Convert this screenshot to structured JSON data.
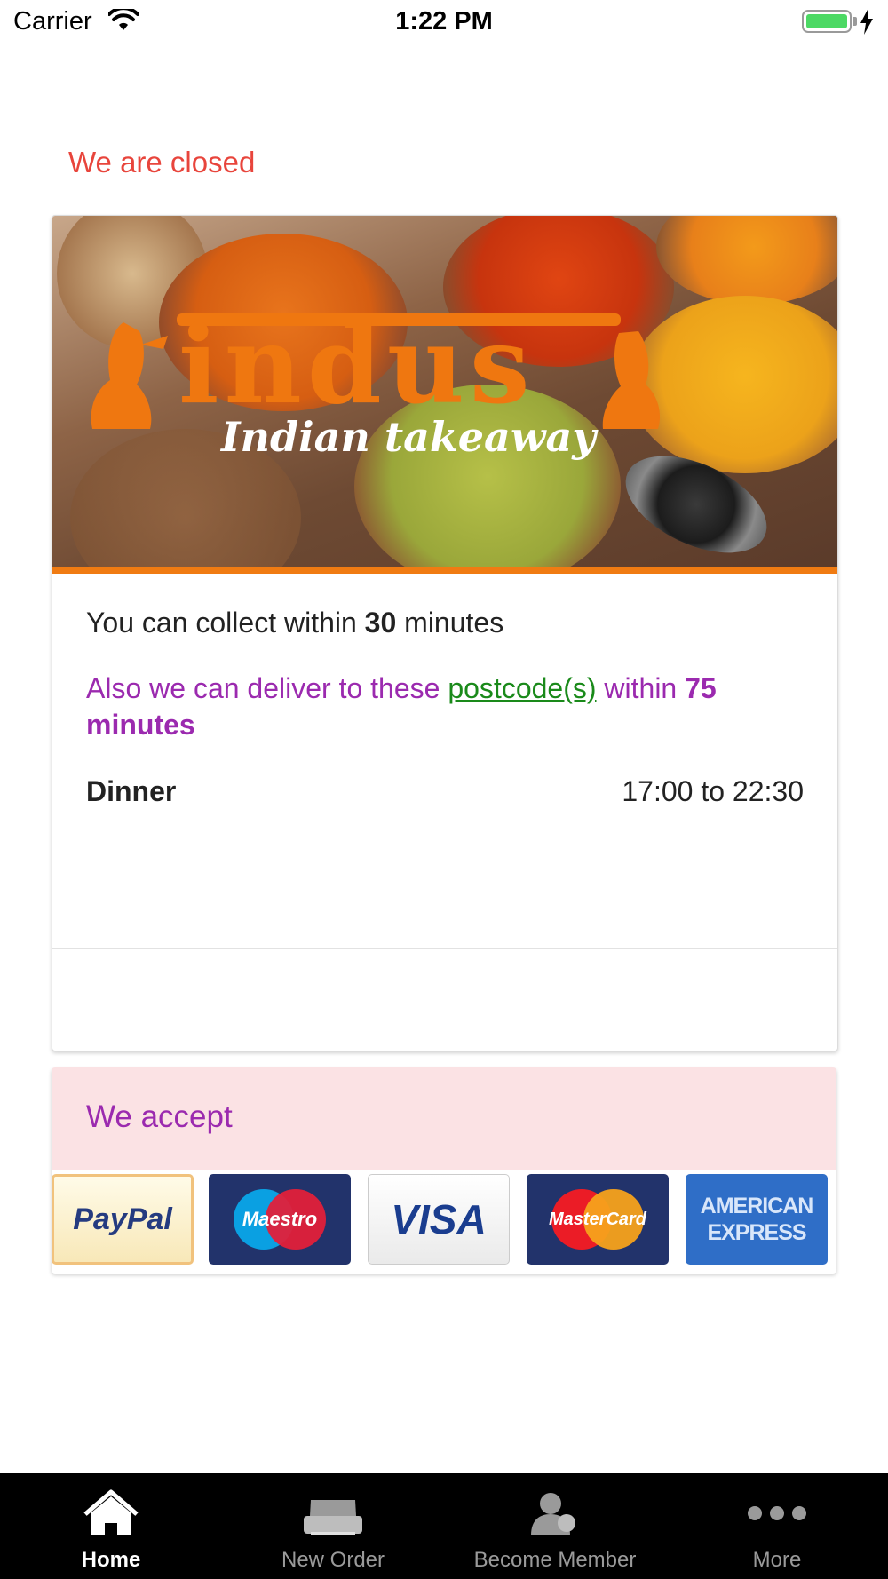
{
  "status_bar": {
    "carrier": "Carrier",
    "time": "1:22 PM"
  },
  "closed_message": "We are closed",
  "hero": {
    "brand": "indus",
    "tagline": "Indian takeaway"
  },
  "collect": {
    "prefix": "You can collect within",
    "minutes": "30",
    "suffix": "minutes"
  },
  "delivery": {
    "prefix": "Also we can deliver to these",
    "link_text": "postcode(s)",
    "middle": "within",
    "minutes": "75",
    "unit": "minutes"
  },
  "meal": {
    "name": "Dinner",
    "hours": "17:00 to 22:30"
  },
  "accept": {
    "title": "We accept",
    "methods": [
      {
        "name": "PayPal"
      },
      {
        "name": "Maestro"
      },
      {
        "name": "VISA"
      },
      {
        "name": "MasterCard"
      },
      {
        "name": "AMERICAN EXPRESS"
      }
    ]
  },
  "tabs": [
    {
      "label": "Home",
      "icon": "home-icon",
      "active": true
    },
    {
      "label": "New Order",
      "icon": "printer-icon",
      "active": false
    },
    {
      "label": "Become Member",
      "icon": "member-icon",
      "active": false
    },
    {
      "label": "More",
      "icon": "more-icon",
      "active": false
    }
  ],
  "colors": {
    "accent_orange": "#f07b12",
    "closed_red": "#e8453c",
    "purple": "#9b2aaf",
    "link_green": "#1a8a1a",
    "accept_bg": "#fbe2e4"
  }
}
